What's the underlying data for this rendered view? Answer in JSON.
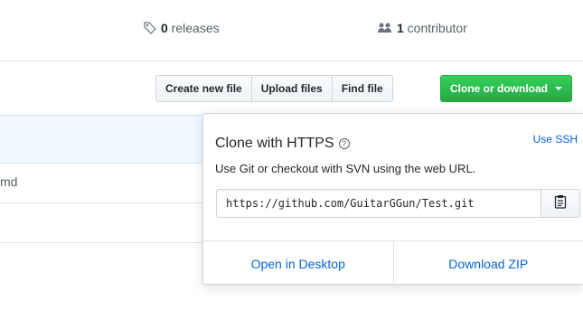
{
  "stats": {
    "releases_count": "0",
    "releases_label": " releases",
    "contributors_count": "1",
    "contributors_label": " contributor"
  },
  "toolbar": {
    "create_new_file": "Create new file",
    "upload_files": "Upload files",
    "find_file": "Find file",
    "clone_or_download": "Clone or download"
  },
  "files": [
    {
      "name": ""
    },
    {
      "name": "md"
    },
    {
      "name": ""
    }
  ],
  "clone_dropdown": {
    "title": "Clone with HTTPS",
    "help_symbol": "?",
    "use_ssh": "Use SSH",
    "description": "Use Git or checkout with SVN using the web URL.",
    "url_value": "https://github.com/GuitarGGun/Test.git",
    "open_in_desktop": "Open in Desktop",
    "download_zip": "Download ZIP"
  },
  "colors": {
    "accent_green": "#28a745",
    "link_blue": "#0366d6",
    "border": "#d1d5da"
  },
  "icons": [
    "tag-icon",
    "people-icon",
    "caret-down-icon",
    "help-icon",
    "clipboard-icon"
  ]
}
